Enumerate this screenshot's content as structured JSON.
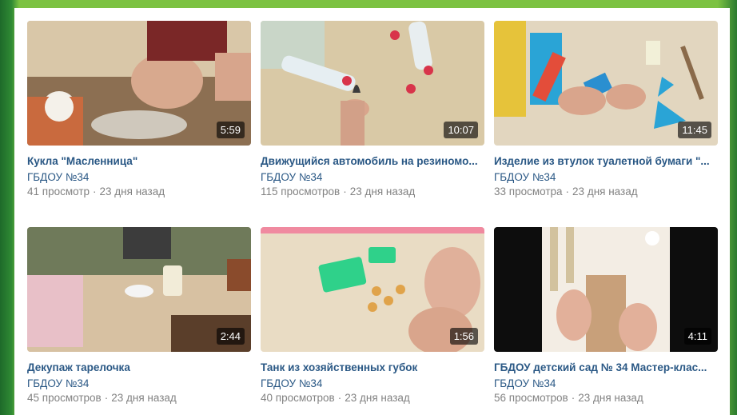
{
  "colors": {
    "frame": "#7cc242",
    "link": "#2a5885",
    "meta": "#828282",
    "badge_bg": "rgba(0,0,0,0.62)"
  },
  "separator": "·",
  "videos": [
    {
      "title": "Кукла \"Масленница\"",
      "channel": "ГБДОУ №34",
      "views": "41 просмотр",
      "age": "23 дня назад",
      "duration": "5:59"
    },
    {
      "title": "Движущийся автомобиль на резиномо...",
      "channel": "ГБДОУ №34",
      "views": "115 просмотров",
      "age": "23 дня назад",
      "duration": "10:07"
    },
    {
      "title": "Изделие из втулок туалетной бумаги \"...",
      "channel": "ГБДОУ №34",
      "views": "33 просмотра",
      "age": "23 дня назад",
      "duration": "11:45"
    },
    {
      "title": "Декупаж тарелочка",
      "channel": "ГБДОУ №34",
      "views": "45 просмотров",
      "age": "23 дня назад",
      "duration": "2:44"
    },
    {
      "title": "Танк из хозяйственных губок",
      "channel": "ГБДОУ №34",
      "views": "40 просмотров",
      "age": "23 дня назад",
      "duration": "1:56"
    },
    {
      "title": "ГБДОУ детский сад № 34 Мастер-клас...",
      "channel": "ГБДОУ №34",
      "views": "56 просмотров",
      "age": "23 дня назад",
      "duration": "4:11"
    }
  ]
}
